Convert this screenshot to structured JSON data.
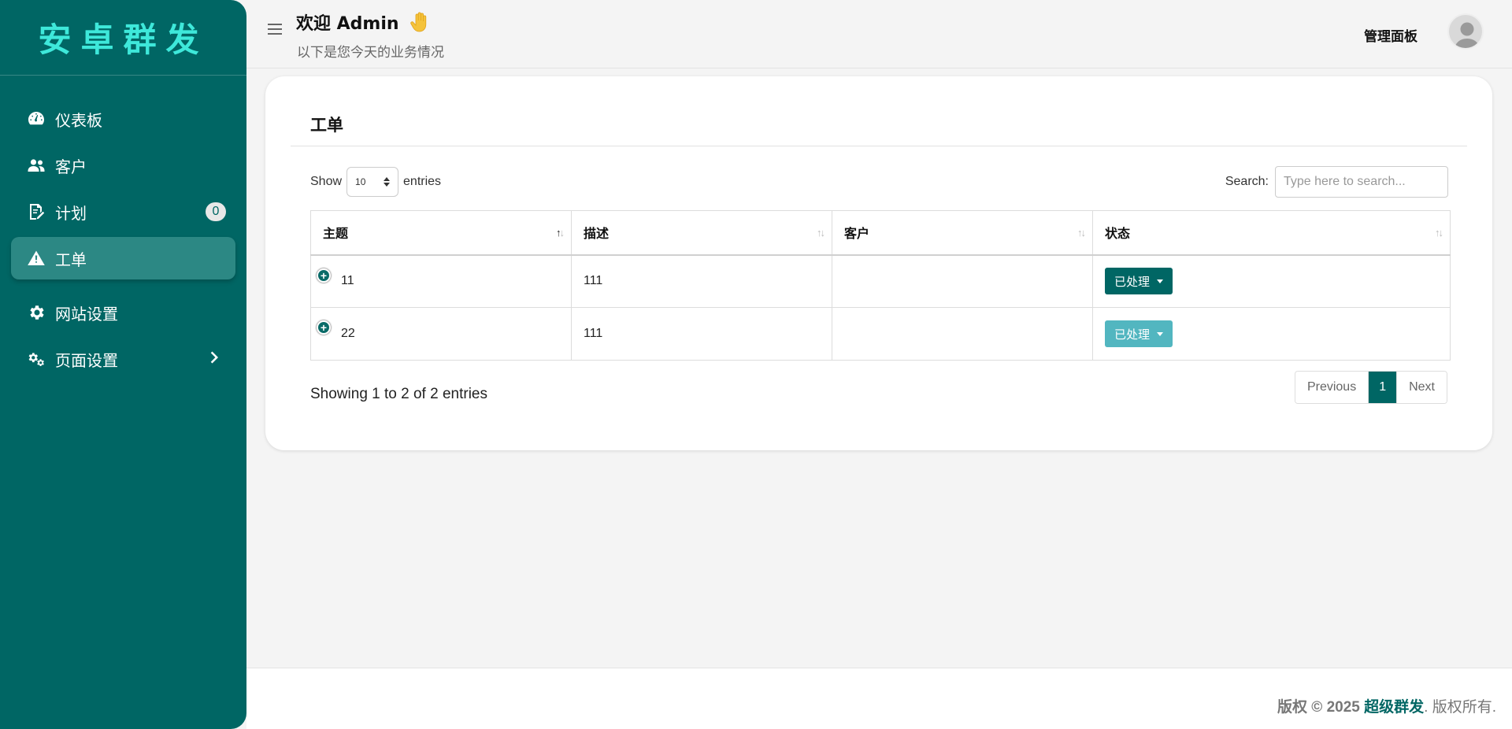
{
  "sidebar": {
    "brand": "安卓群发",
    "items": [
      {
        "label": "仪表板",
        "icon": "dashboard-gauge-icon"
      },
      {
        "label": "客户",
        "icon": "users-icon"
      },
      {
        "label": "计划",
        "icon": "edit-document-icon",
        "badge": "0"
      },
      {
        "label": "工单",
        "icon": "warning-icon",
        "active": true
      },
      {
        "label": "网站设置",
        "icon": "gear-icon"
      },
      {
        "label": "页面设置",
        "icon": "gears-icon",
        "chevron": true
      }
    ]
  },
  "topbar": {
    "welcome": "欢迎 Admin",
    "subtitle": "以下是您今天的业务情况",
    "dashboard_link": "管理面板"
  },
  "card": {
    "title": "工单",
    "show_label": "Show",
    "entries_label": "entries",
    "page_length": "10",
    "search_label": "Search:",
    "search_placeholder": "Type here to search...",
    "columns": [
      "主题",
      "描述",
      "客户",
      "状态"
    ],
    "rows": [
      {
        "subject": "11",
        "description": "111",
        "customer": "",
        "status": "已处理"
      },
      {
        "subject": "22",
        "description": "111",
        "customer": "",
        "status": "已处理"
      }
    ],
    "info": "Showing 1 to 2 of 2 entries",
    "pagination": {
      "previous": "Previous",
      "current": "1",
      "next": "Next"
    }
  },
  "footer": {
    "copyright": "版权 © 2025",
    "brand": "超级群发",
    "suffix": ". 版权所有."
  },
  "colors": {
    "primary": "#006664",
    "brand_text": "#3ee8da",
    "status_light": "#52b6c0"
  }
}
